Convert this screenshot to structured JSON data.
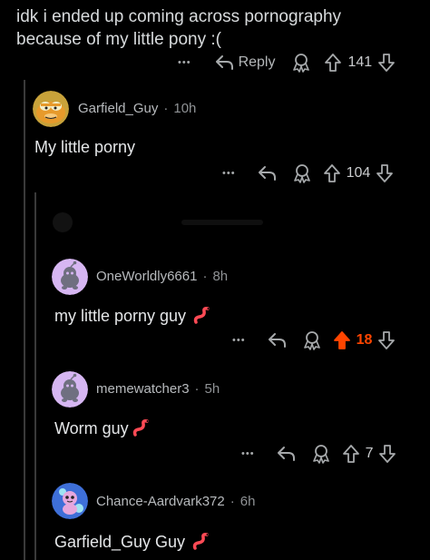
{
  "post": {
    "title_line1": "idk i ended up coming across pornography",
    "title_line2": "because of my little pony :(",
    "more_label": "•••",
    "reply_label": "Reply",
    "score": "141"
  },
  "comments": [
    {
      "username": "Garfield_Guy",
      "age": "10h",
      "body": "My little porny",
      "more_label": "•••",
      "score": "104"
    },
    {
      "username": "OneWorldly6661",
      "age": "8h",
      "body": "my little porny guy",
      "more_label": "•••",
      "score": "18",
      "upvoted": true
    },
    {
      "username": "memewatcher3",
      "age": "5h",
      "body": "Worm guy",
      "more_label": "•••",
      "score": "7"
    },
    {
      "username": "Chance-Aardvark372",
      "age": "6h",
      "body": "Garfield_Guy Guy"
    }
  ],
  "colors": {
    "background": "#000000",
    "upvote_active": "#ff4500",
    "worm": "#ff4a55"
  }
}
